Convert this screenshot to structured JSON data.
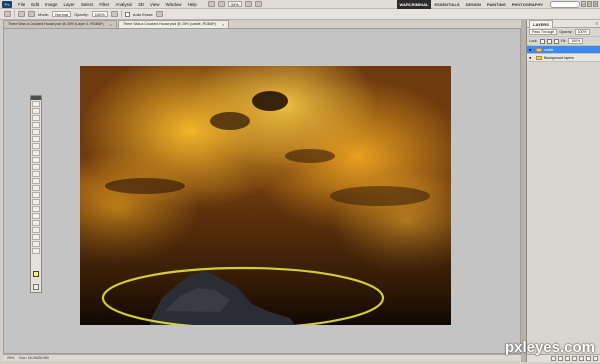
{
  "app": {
    "logo": "Ps"
  },
  "menu": {
    "items": [
      "File",
      "Edit",
      "Image",
      "Layer",
      "Select",
      "Filter",
      "Analysis",
      "3D",
      "View",
      "Window",
      "Help"
    ],
    "zoom_level": "33%"
  },
  "workspaces": {
    "items": [
      "WARCRIMINAL",
      "ESSENTIALS",
      "DESIGN",
      "PAINTING",
      "PHOTOGRAPHY"
    ],
    "active_index": 0
  },
  "options_bar": {
    "mode_label": "Mode:",
    "mode_value": "Normal",
    "opacity_label": "Opacity:",
    "opacity_value": "100%",
    "autoerase_label": "Auto Erase"
  },
  "document_tabs": [
    {
      "title": "There Was a Crooked House.psd @ 25% (Layer 0, RGB/8*)"
    },
    {
      "title": "There Was a Crooked House.psd @ 25% (castle, RGB/8*)"
    }
  ],
  "status_bar": {
    "zoom": "25%",
    "doc_info": "Doc: 16.2M/94.8M"
  },
  "layers_panel": {
    "tab_label": "LAYERS",
    "blend_mode": "Pass Through",
    "opacity_label": "Opacity:",
    "opacity_value": "100%",
    "lock_label": "Lock:",
    "fill_label": "Fill:",
    "fill_value": "100%",
    "layers": [
      {
        "name": "castle",
        "selected": true
      },
      {
        "name": "Background layers",
        "selected": false
      }
    ]
  },
  "colors": {
    "foreground": "#fff45c",
    "background": "#ffffff",
    "selection_ellipse": "#e6e03a",
    "layer_highlight": "#3d8af0"
  },
  "watermark": "pxleyes.com"
}
